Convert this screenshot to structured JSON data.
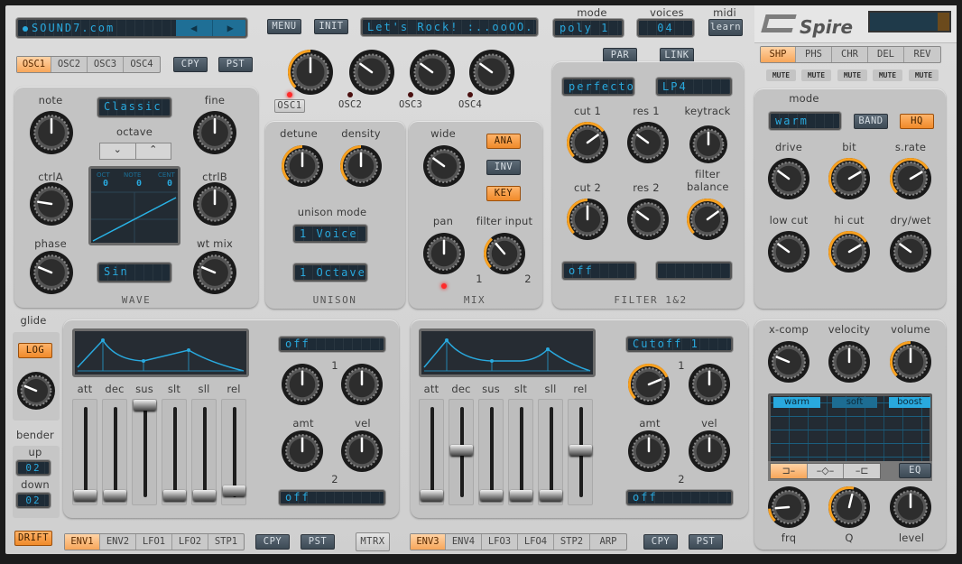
{
  "header": {
    "preset_browser": {
      "value": "SOUND7.com",
      "prev_icon": "triangle-left",
      "next_icon": "triangle-right"
    },
    "menu_label": "MENU",
    "init_label": "INIT",
    "preset_name": "Let's Rock! :..ooOO..",
    "mode": {
      "label": "mode",
      "value": "poly 1"
    },
    "voices": {
      "label": "voices",
      "value": "04"
    },
    "midi": {
      "label": "midi",
      "button": "learn"
    },
    "logo": "Spire"
  },
  "osc_section": {
    "tabs": [
      {
        "label": "OSC1",
        "active": true
      },
      {
        "label": "OSC2",
        "active": false
      },
      {
        "label": "OSC3",
        "active": false
      },
      {
        "label": "OSC4",
        "active": false
      }
    ],
    "copy_label": "CPY",
    "paste_label": "PST",
    "mix_knobs": [
      {
        "label": "OSC1",
        "value": 0.5,
        "arc": true,
        "led_on": true
      },
      {
        "label": "OSC2",
        "value": 0.3,
        "arc": false,
        "led_on": false
      },
      {
        "label": "OSC3",
        "value": 0.3,
        "arc": false,
        "led_on": false
      },
      {
        "label": "OSC4",
        "value": 0.3,
        "arc": false,
        "led_on": false
      }
    ]
  },
  "oscillator": {
    "note": {
      "label": "note",
      "value": 0.5
    },
    "fine": {
      "label": "fine",
      "value": 0.5
    },
    "ctrlA": {
      "label": "ctrlA",
      "value": 0.2
    },
    "ctrlB": {
      "label": "ctrlB",
      "value": 0.5
    },
    "phase": {
      "label": "phase",
      "value": 0.25
    },
    "wt_mix": {
      "label": "wt mix",
      "value": 0.25
    },
    "type_select": "Classic",
    "octave_label": "octave",
    "octave_down": "⌄",
    "octave_up": "⌃",
    "display": {
      "oct_label": "OCT",
      "note_label": "NOTE",
      "cent_label": "CENT",
      "oct": "0",
      "note": "0",
      "cent": "0"
    },
    "wave_select": "Sin",
    "section_label": "WAVE"
  },
  "unison": {
    "detune": {
      "label": "detune",
      "value": 0.5,
      "arc": true
    },
    "density": {
      "label": "density",
      "value": 0.5,
      "arc": true
    },
    "mode_label": "unison mode",
    "mode_value": "1 Voice",
    "octave_value": "1 Octave",
    "section_label": "UNISON"
  },
  "mix": {
    "wide": {
      "label": "wide",
      "value": 0.3
    },
    "pan": {
      "label": "pan",
      "value": 0.5
    },
    "filter_input": {
      "label": "filter input",
      "value": 0.35,
      "arc": true,
      "min_label": "1",
      "max_label": "2"
    },
    "ana_label": "ANA",
    "ana_on": true,
    "inv_label": "INV",
    "inv_on": false,
    "key_label": "KEY",
    "key_on": true,
    "section_label": "MIX"
  },
  "filter": {
    "par_label": "PAR",
    "link_label": "LINK",
    "filter1_type": "perfecto",
    "filter2_type": "LP4",
    "cut1": {
      "label": "cut 1",
      "value": 0.7,
      "arc": true
    },
    "res1": {
      "label": "res 1",
      "value": 0.3
    },
    "keytrack": {
      "label": "keytrack",
      "value": 0.5
    },
    "cut2": {
      "label": "cut 2",
      "value": 0.5,
      "arc": true
    },
    "res2": {
      "label": "res 2",
      "value": 0.3
    },
    "balance": {
      "label": "filter balance",
      "value": 0.7,
      "arc": true
    },
    "mod1": "off",
    "mod2": "",
    "section_label": "FILTER 1&2"
  },
  "fx": {
    "tabs": [
      {
        "label": "SHP",
        "active": true
      },
      {
        "label": "PHS",
        "active": false
      },
      {
        "label": "CHR",
        "active": false
      },
      {
        "label": "DEL",
        "active": false
      },
      {
        "label": "REV",
        "active": false
      }
    ],
    "mute_label": "MUTE",
    "mode_label": "mode",
    "mode_value": "warm",
    "band_label": "BAND",
    "band_on": false,
    "hq_label": "HQ",
    "hq_on": true,
    "drive": {
      "label": "drive",
      "value": 0.3
    },
    "bit": {
      "label": "bit",
      "value": 0.72,
      "arc": true
    },
    "srate": {
      "label": "s.rate",
      "value": 0.72,
      "arc": true
    },
    "low_cut": {
      "label": "low cut",
      "value": 0.3
    },
    "hi_cut": {
      "label": "hi cut",
      "value": 0.72,
      "arc": true
    },
    "dry_wet": {
      "label": "dry/wet",
      "value": 0.3
    }
  },
  "master": {
    "xcomp": {
      "label": "x-comp",
      "value": 0.25
    },
    "velocity": {
      "label": "velocity",
      "value": 0.5
    },
    "volume": {
      "label": "volume",
      "value": 0.5,
      "arc": true
    },
    "eq_modes": [
      {
        "label": "warm",
        "active": true
      },
      {
        "label": "soft",
        "active": false
      },
      {
        "label": "boost",
        "active": true
      }
    ],
    "eq_shapes": [
      {
        "icon": "low-shelf-icon",
        "active": true
      },
      {
        "icon": "peak-icon",
        "active": false
      },
      {
        "icon": "high-shelf-icon",
        "active": false
      }
    ],
    "eq_label": "EQ",
    "frq": {
      "label": "frq",
      "value": 0.15,
      "arc": true
    },
    "q": {
      "label": "Q",
      "value": 0.55,
      "arc": true
    },
    "level": {
      "label": "level",
      "value": 0.5
    }
  },
  "glide": {
    "label": "glide",
    "log_label": "LOG",
    "value": 0.25
  },
  "bender": {
    "label": "bender",
    "up_label": "up",
    "up_value": "02",
    "down_label": "down",
    "down_value": "02"
  },
  "drift_label": "DRIFT",
  "mod1": {
    "env_labels": [
      "att",
      "dec",
      "sus",
      "slt",
      "sll",
      "rel"
    ],
    "faders": [
      0.0,
      0.0,
      1.0,
      0.0,
      0.0,
      0.05
    ],
    "dest1": "off",
    "dest2": "off",
    "amt_label": "amt",
    "vel_label": "vel",
    "slot1": "1",
    "slot2": "2",
    "amt1": 0.5,
    "vel1": 0.5,
    "amt2": 0.5,
    "vel2": 0.5,
    "tabs": [
      {
        "label": "ENV1",
        "active": true
      },
      {
        "label": "ENV2",
        "active": false
      },
      {
        "label": "LFO1",
        "active": false
      },
      {
        "label": "LFO2",
        "active": false
      },
      {
        "label": "STP1",
        "active": false
      }
    ],
    "copy_label": "CPY",
    "paste_label": "PST",
    "matrix_label": "MTRX"
  },
  "mod2": {
    "env_labels": [
      "att",
      "dec",
      "sus",
      "slt",
      "sll",
      "rel"
    ],
    "faders": [
      0.0,
      0.5,
      0.0,
      0.0,
      0.0,
      0.5
    ],
    "dest1": "Cutoff 1",
    "dest2": "off",
    "amt_label": "amt",
    "vel_label": "vel",
    "slot1": "1",
    "slot2": "2",
    "amt1": 0.75,
    "amt1_arc": true,
    "vel1": 0.5,
    "amt2": 0.5,
    "vel2": 0.5,
    "tabs": [
      {
        "label": "ENV3",
        "active": true
      },
      {
        "label": "ENV4",
        "active": false
      },
      {
        "label": "LFO3",
        "active": false
      },
      {
        "label": "LFO4",
        "active": false
      },
      {
        "label": "STP2",
        "active": false
      },
      {
        "label": "ARP",
        "active": false
      }
    ],
    "copy_label": "CPY",
    "paste_label": "PST"
  },
  "colors": {
    "accent": "#f7a020",
    "lcd_text": "#29a9de",
    "lcd_bg": "#1e2b36",
    "panel": "#c3c3c3"
  }
}
